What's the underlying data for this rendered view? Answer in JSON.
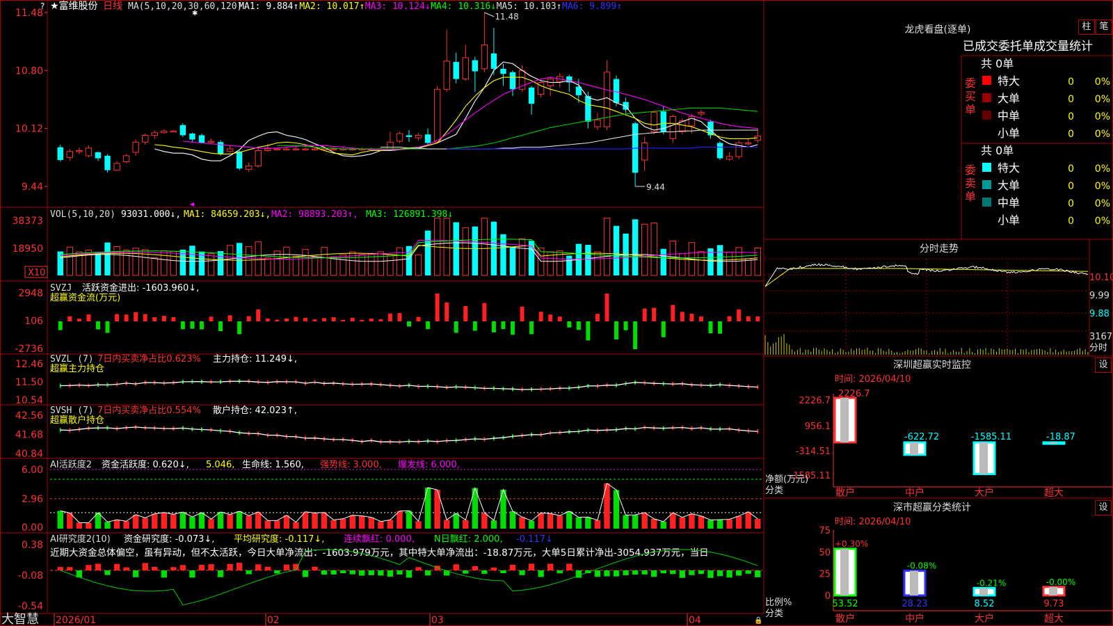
{
  "stock": {
    "star": "★",
    "name": "富维股份",
    "period": "日线",
    "ma_header": [
      {
        "text": "MA(5,10,20,30,60,120)",
        "color": "#dddddd"
      },
      {
        "text": "MA1: 9.884↑",
        "color": "#ffffff"
      },
      {
        "text": "MA2: 10.017↑",
        "color": "#ffff00"
      },
      {
        "text": "MA3: 10.124↓",
        "color": "#ff00ff"
      },
      {
        "text": "MA4: 10.316↓",
        "color": "#00ff00"
      },
      {
        "text": "MA5: 10.103↑",
        "color": "#dddddd"
      },
      {
        "text": "MA6: 9.899↑",
        "color": "#3333ff"
      }
    ],
    "high_mark": "11.48",
    "low_mark": "9.44",
    "price_ticks": [
      "11.48",
      "10.80",
      "10.12",
      "9.44"
    ],
    "question": "?"
  },
  "candles": [
    {
      "o": 9.9,
      "c": 9.75,
      "h": 9.93,
      "l": 9.73
    },
    {
      "o": 9.78,
      "c": 9.85,
      "h": 9.88,
      "l": 9.74
    },
    {
      "o": 9.86,
      "c": 9.86,
      "h": 9.9,
      "l": 9.82
    },
    {
      "o": 9.8,
      "c": 9.89,
      "h": 9.92,
      "l": 9.78
    },
    {
      "o": 9.84,
      "c": 9.77,
      "h": 9.85,
      "l": 9.74
    },
    {
      "o": 9.8,
      "c": 9.63,
      "h": 9.82,
      "l": 9.6
    },
    {
      "o": 9.63,
      "c": 9.71,
      "h": 9.74,
      "l": 9.62
    },
    {
      "o": 9.73,
      "c": 9.8,
      "h": 9.82,
      "l": 9.71
    },
    {
      "o": 9.84,
      "c": 9.96,
      "h": 9.99,
      "l": 9.8
    },
    {
      "o": 9.96,
      "c": 10.04,
      "h": 10.06,
      "l": 9.93
    },
    {
      "o": 10.04,
      "c": 10.07,
      "h": 10.1,
      "l": 10.0
    },
    {
      "o": 10.07,
      "c": 10.09,
      "h": 10.11,
      "l": 10.06
    },
    {
      "o": 10.09,
      "c": 10.09,
      "h": 10.1,
      "l": 10.08
    },
    {
      "o": 10.16,
      "c": 10.04,
      "h": 10.18,
      "l": 10.02
    },
    {
      "o": 10.06,
      "c": 9.99,
      "h": 10.07,
      "l": 9.96
    },
    {
      "o": 10.04,
      "c": 9.95,
      "h": 10.06,
      "l": 9.94
    },
    {
      "o": 9.97,
      "c": 9.97,
      "h": 10.0,
      "l": 9.95
    },
    {
      "o": 9.96,
      "c": 9.82,
      "h": 9.98,
      "l": 9.8
    },
    {
      "o": 9.85,
      "c": 9.88,
      "h": 9.92,
      "l": 9.84
    },
    {
      "o": 9.85,
      "c": 9.65,
      "h": 9.86,
      "l": 9.63
    },
    {
      "o": 9.64,
      "c": 9.68,
      "h": 9.72,
      "l": 9.61
    },
    {
      "o": 9.68,
      "c": 9.86,
      "h": 9.89,
      "l": 9.66
    },
    {
      "o": 9.86,
      "c": 9.88,
      "h": 9.94,
      "l": 9.85
    },
    {
      "o": 9.88,
      "c": 9.88,
      "h": 9.9,
      "l": 9.86
    },
    {
      "o": 9.88,
      "c": 9.88,
      "h": 9.9,
      "l": 9.86
    },
    {
      "o": 9.88,
      "c": 9.88,
      "h": 9.9,
      "l": 9.86
    },
    {
      "o": 9.88,
      "c": 9.88,
      "h": 9.9,
      "l": 9.86
    },
    {
      "o": 9.88,
      "c": 9.88,
      "h": 9.9,
      "l": 9.86
    },
    {
      "o": 9.88,
      "c": 9.88,
      "h": 9.9,
      "l": 9.86
    },
    {
      "o": 9.88,
      "c": 9.88,
      "h": 9.9,
      "l": 9.86
    },
    {
      "o": 9.88,
      "c": 9.88,
      "h": 9.9,
      "l": 9.86
    },
    {
      "o": 9.88,
      "c": 9.88,
      "h": 9.9,
      "l": 9.86
    },
    {
      "o": 9.88,
      "c": 9.88,
      "h": 9.9,
      "l": 9.86
    },
    {
      "o": 9.88,
      "c": 9.88,
      "h": 9.9,
      "l": 9.86
    },
    {
      "o": 9.88,
      "c": 9.88,
      "h": 9.9,
      "l": 9.86
    },
    {
      "o": 9.88,
      "c": 9.96,
      "h": 10.08,
      "l": 9.86
    },
    {
      "o": 9.97,
      "c": 10.06,
      "h": 10.08,
      "l": 9.95
    },
    {
      "o": 10.04,
      "c": 10.02,
      "h": 10.1,
      "l": 9.96
    },
    {
      "o": 10.01,
      "c": 10.04,
      "h": 10.07,
      "l": 9.98
    },
    {
      "o": 10.05,
      "c": 9.95,
      "h": 10.12,
      "l": 9.93
    },
    {
      "o": 9.96,
      "c": 10.58,
      "h": 10.62,
      "l": 9.94
    },
    {
      "o": 10.58,
      "c": 10.91,
      "h": 11.28,
      "l": 10.55
    },
    {
      "o": 10.9,
      "c": 10.7,
      "h": 11.01,
      "l": 10.65
    },
    {
      "o": 10.7,
      "c": 10.95,
      "h": 11.1,
      "l": 10.68
    },
    {
      "o": 10.92,
      "c": 10.79,
      "h": 10.96,
      "l": 10.55
    },
    {
      "o": 10.82,
      "c": 11.1,
      "h": 11.48,
      "l": 10.78
    },
    {
      "o": 11.0,
      "c": 10.82,
      "h": 11.3,
      "l": 10.75
    },
    {
      "o": 10.82,
      "c": 10.76,
      "h": 10.88,
      "l": 10.62
    },
    {
      "o": 10.78,
      "c": 10.58,
      "h": 10.8,
      "l": 10.5
    },
    {
      "o": 10.58,
      "c": 10.8,
      "h": 10.86,
      "l": 10.55
    },
    {
      "o": 10.6,
      "c": 10.41,
      "h": 10.62,
      "l": 10.28
    },
    {
      "o": 10.52,
      "c": 10.66,
      "h": 10.68,
      "l": 10.48
    },
    {
      "o": 10.62,
      "c": 10.7,
      "h": 10.72,
      "l": 10.5
    },
    {
      "o": 10.67,
      "c": 10.73,
      "h": 10.77,
      "l": 10.6
    },
    {
      "o": 10.73,
      "c": 10.66,
      "h": 10.75,
      "l": 10.55
    },
    {
      "o": 10.61,
      "c": 10.51,
      "h": 10.7,
      "l": 10.42
    },
    {
      "o": 10.5,
      "c": 10.2,
      "h": 10.55,
      "l": 10.12
    },
    {
      "o": 10.14,
      "c": 10.22,
      "h": 10.3,
      "l": 10.1
    },
    {
      "o": 10.14,
      "c": 10.78,
      "h": 10.92,
      "l": 10.1
    },
    {
      "o": 10.7,
      "c": 10.42,
      "h": 10.74,
      "l": 10.38
    },
    {
      "o": 10.43,
      "c": 10.34,
      "h": 10.48,
      "l": 10.3
    },
    {
      "o": 10.18,
      "c": 9.6,
      "h": 10.2,
      "l": 9.44
    },
    {
      "o": 9.75,
      "c": 9.95,
      "h": 10.02,
      "l": 9.62
    },
    {
      "o": 10.08,
      "c": 10.31,
      "h": 10.33,
      "l": 10.05
    },
    {
      "o": 10.32,
      "c": 10.08,
      "h": 10.38,
      "l": 10.05
    },
    {
      "o": 10.0,
      "c": 10.26,
      "h": 10.28,
      "l": 9.95
    },
    {
      "o": 10.08,
      "c": 10.21,
      "h": 10.24,
      "l": 10.05
    },
    {
      "o": 10.15,
      "c": 10.26,
      "h": 10.29,
      "l": 10.06
    },
    {
      "o": 10.29,
      "c": 10.31,
      "h": 10.34,
      "l": 10.26
    },
    {
      "o": 10.2,
      "c": 10.04,
      "h": 10.22,
      "l": 10.0
    },
    {
      "o": 9.95,
      "c": 9.77,
      "h": 9.97,
      "l": 9.75
    },
    {
      "o": 9.76,
      "c": 9.79,
      "h": 9.84,
      "l": 9.74
    },
    {
      "o": 9.79,
      "c": 9.95,
      "h": 9.98,
      "l": 9.76
    },
    {
      "o": 9.94,
      "c": 9.95,
      "h": 10.0,
      "l": 9.92
    },
    {
      "o": 9.98,
      "c": 10.03,
      "h": 10.12,
      "l": 9.95
    }
  ],
  "ma_lines": [
    {
      "color": "#ffffff",
      "pts": [
        9.88,
        9.85,
        9.83,
        9.83,
        9.81,
        9.76,
        9.74,
        9.74,
        9.8,
        9.87,
        9.98,
        10.03,
        10.07,
        10.08,
        10.04,
        10.02,
        9.99,
        9.94,
        9.9,
        9.84,
        9.8,
        9.79,
        9.8,
        9.82,
        9.86,
        9.86,
        9.87,
        9.88,
        9.89,
        9.92,
        9.95,
        10.0,
        10.05,
        10.24,
        10.44,
        10.6,
        10.8,
        10.9,
        10.88,
        10.8,
        10.73,
        10.68,
        10.66,
        10.66,
        10.68,
        10.63,
        10.48,
        10.45,
        10.48,
        10.42,
        10.38,
        10.24,
        10.14,
        10.1,
        10.12,
        10.16,
        10.2,
        10.24,
        10.2,
        10.1,
        10.0,
        9.94,
        9.92,
        9.9,
        9.93
      ]
    },
    {
      "color": "#ffff00",
      "pts": [
        9.93,
        9.92,
        9.9,
        9.89,
        9.87,
        9.85,
        9.83,
        9.82,
        9.82,
        9.84,
        9.87,
        9.9,
        9.92,
        9.95,
        9.96,
        9.95,
        9.93,
        9.9,
        9.86,
        9.83,
        9.82,
        9.81,
        9.84,
        9.86,
        9.86,
        9.87,
        9.88,
        9.89,
        9.9,
        9.92,
        9.95,
        10.08,
        10.22,
        10.38,
        10.5,
        10.6,
        10.68,
        10.72,
        10.72,
        10.72,
        10.68,
        10.62,
        10.58,
        10.55,
        10.52,
        10.45,
        10.4,
        10.38,
        10.36,
        10.32,
        10.28,
        10.24,
        10.18,
        10.16,
        10.18,
        10.18,
        10.16,
        10.14,
        10.1,
        10.06,
        10.02,
        10.0,
        10.0,
        10.0,
        10.01
      ]
    },
    {
      "color": "#ff00ff",
      "pts": [
        9.97,
        9.96,
        9.95,
        9.94,
        9.93,
        9.92,
        9.91,
        9.9,
        9.89,
        9.89,
        9.89,
        9.9,
        9.91,
        9.92,
        9.92,
        9.92,
        9.91,
        9.9,
        9.89,
        9.88,
        9.87,
        9.87,
        9.87,
        9.87,
        9.88,
        9.9,
        9.93,
        9.98,
        10.05,
        10.13,
        10.22,
        10.3,
        10.38,
        10.45,
        10.52,
        10.57,
        10.62,
        10.66,
        10.7,
        10.72,
        10.7,
        10.68,
        10.66,
        10.63,
        10.6,
        10.57,
        10.55,
        10.52,
        10.49,
        10.46,
        10.42,
        10.38,
        10.34,
        10.3,
        10.27,
        10.24,
        10.21,
        10.18,
        10.16,
        10.14,
        10.13,
        10.12
      ]
    },
    {
      "color": "#00cc00",
      "pts": [
        9.92,
        9.92,
        9.92,
        9.91,
        9.9,
        9.89,
        9.89,
        9.88,
        9.88,
        9.88,
        9.88,
        9.88,
        9.88,
        9.88,
        9.88,
        9.88,
        9.88,
        9.88,
        9.88,
        9.89,
        9.9,
        9.91,
        9.93,
        9.95,
        9.98,
        10.01,
        10.04,
        10.07,
        10.1,
        10.13,
        10.15,
        10.17,
        10.19,
        10.21,
        10.23,
        10.25,
        10.27,
        10.29,
        10.3,
        10.31,
        10.32,
        10.33,
        10.34,
        10.35,
        10.36,
        10.36,
        10.36,
        10.36,
        10.35,
        10.34,
        10.33,
        10.32
      ]
    },
    {
      "color": "#dddddd",
      "pts": [
        9.9,
        9.9,
        9.9,
        9.89,
        9.89,
        9.88,
        9.88,
        9.88,
        9.88,
        9.88,
        9.88,
        9.88,
        9.88,
        9.89,
        9.89,
        9.9,
        9.9,
        9.9,
        9.91,
        9.92,
        9.93,
        9.94,
        9.95,
        9.97,
        9.99,
        10.01,
        10.03,
        10.05,
        10.06,
        10.07,
        10.08,
        10.08,
        10.09,
        10.09,
        10.1,
        10.1,
        10.1,
        10.1,
        10.1,
        10.1,
        10.1
      ]
    },
    {
      "color": "#2222ff",
      "pts": [
        9.88,
        9.88,
        9.88,
        9.88,
        9.88,
        9.88,
        9.88,
        9.88,
        9.88,
        9.88,
        9.88,
        9.88,
        9.88,
        9.88,
        9.88,
        9.88,
        9.88,
        9.88,
        9.88,
        9.88,
        9.89,
        9.89,
        9.89,
        9.89,
        9.89,
        9.89,
        9.89,
        9.9,
        9.9,
        9.9,
        9.9,
        9.9,
        9.9,
        9.9
      ]
    }
  ],
  "vol_panel": {
    "label": "VOL(5,10,20)",
    "value": "93031.000↓,",
    "ma1": "MA1: 84659.203↓,",
    "ma2": "MA2: 98893.203↑,",
    "ma3": "MA3: 126891.398↓",
    "ticks": [
      "38373",
      "18950",
      "X10"
    ]
  },
  "svzj_panel": {
    "label": "SVZJ",
    "text": "活跃资金进出: -1603.960↓,",
    "sub": "超赢资金流(万元)",
    "ticks": [
      "2948",
      "106",
      "-2736"
    ]
  },
  "svzl_panel": {
    "label": "SVZL (7)",
    "ratio": "7日内买卖净占比0.623%",
    "hold": "主力持仓: 11.249↓,",
    "sub": "超赢主力持仓",
    "ticks": [
      "12.46",
      "11.50",
      "10.54"
    ]
  },
  "svsh_panel": {
    "label": "SVSH (7)",
    "ratio": "7日内买卖净占比0.554%",
    "hold": "散户持仓: 42.023↑,",
    "sub": "超赢散户持仓",
    "ticks": [
      "42.56",
      "41.68",
      "40.84"
    ]
  },
  "ai1_panel": {
    "label": "AI活跃度2",
    "a": "资金活跃度: 0.620↓,",
    "b": "5.046,",
    "c": "生命线: 1.560,",
    "d": "强势线: 3.000,",
    "e": "爆发线: 6.000,",
    "ticks": [
      "6.00",
      "2.96",
      "0.00"
    ]
  },
  "ai2_panel": {
    "label": "AI研究度2(10)",
    "a": "资金研究度: -0.073↓,",
    "b": "平均研究度: -0.117↓,",
    "c": "连续飘红: 0.000,",
    "d": "N日飘红: 2.000,",
    "e": "-0.117↓",
    "comment": "近期大资金总体偏空，虽有异动，但不太活跃，今日大单净流出：-1603.979万元，其中特大单净流出：-18.87万元，大单5日累计净出-3054.937万元，当日",
    "ticks": [
      "0.38",
      "-0.08",
      "-0.54"
    ]
  },
  "bottom": {
    "brand": "大智慧",
    "months": [
      "2026/01",
      "02",
      "03",
      "04"
    ]
  },
  "right": {
    "dragon_title": "龙虎看盘(逐单)",
    "btn_a": "柱",
    "btn_b": "笔",
    "stat_title": "已成交委托单成交量统计",
    "buy_label": "委买单",
    "sell_label": "委卖单",
    "buy_total": "共 0单",
    "sell_total": "共 0单",
    "buy_rows": [
      {
        "name": "特大",
        "count": "0",
        "pct": "0%",
        "color": "#ff0000"
      },
      {
        "name": "大单",
        "count": "0",
        "pct": "0%",
        "color": "#990000"
      },
      {
        "name": "中单",
        "count": "0",
        "pct": "0%",
        "color": "#660000"
      },
      {
        "name": "小单",
        "count": "0",
        "pct": "0%",
        "color": ""
      }
    ],
    "sell_rows": [
      {
        "name": "特大",
        "count": "0",
        "pct": "0%",
        "color": "#00ffff"
      },
      {
        "name": "大单",
        "count": "0",
        "pct": "0%",
        "color": "#009999"
      },
      {
        "name": "中单",
        "count": "0",
        "pct": "0%",
        "color": "#007777"
      },
      {
        "name": "小单",
        "count": "0",
        "pct": "0%",
        "color": ""
      }
    ],
    "intraday_title": "分时走势",
    "intraday_ticks": [
      "10.10",
      "9.99",
      "9.88",
      "3167",
      "分时"
    ],
    "sz_title": "深圳超赢实时监控",
    "sz_setting": "设",
    "sz_time": "时间: 2026/04/10",
    "sz_ticks": [
      "2226.7",
      "956.1",
      "-314.51",
      "-1585.11"
    ],
    "sz_ylabel": "净额(万元)",
    "sz_xlabel": "分类",
    "sz_bars": [
      {
        "cat": "散户",
        "label": "2226.7",
        "value": 2226.7,
        "color": "#ff3333"
      },
      {
        "cat": "中户",
        "label": "-622.72",
        "value": -622.72,
        "color": "#00ffff"
      },
      {
        "cat": "大户",
        "label": "-1585.11",
        "value": -1585.11,
        "color": "#00ffff"
      },
      {
        "cat": "超大",
        "label": "-18.87",
        "value": -18.87,
        "color": "#00ffff"
      }
    ],
    "cls_title": "深市超赢分类统计",
    "cls_setting": "设",
    "cls_time": "时间: 2026/04/10",
    "cls_ticks": [
      "75",
      "50",
      "25",
      "0"
    ],
    "cls_ylabel": "比例%",
    "cls_xlabel": "分类",
    "cls_bars": [
      {
        "cat": "散户",
        "val_label": "53.52",
        "delta": "+0.30%",
        "value": 53.52,
        "color": "#00ff00",
        "dcolor": "#ff3333"
      },
      {
        "cat": "中户",
        "val_label": "28.23",
        "delta": "-0.08%",
        "value": 28.23,
        "color": "#3333ff",
        "dcolor": "#00ff00"
      },
      {
        "cat": "大户",
        "val_label": "8.52",
        "delta": "-0.21%",
        "value": 8.52,
        "color": "#00ffff",
        "dcolor": "#00ff00"
      },
      {
        "cat": "超大",
        "val_label": "9.73",
        "delta": "-0.00%",
        "value": 9.73,
        "color": "#ff3333",
        "dcolor": "#00ff00"
      }
    ]
  },
  "colors": {
    "up": "#ff3232",
    "down": "#00ffff",
    "frame": "#aa0000",
    "axis": "#ff3232"
  }
}
